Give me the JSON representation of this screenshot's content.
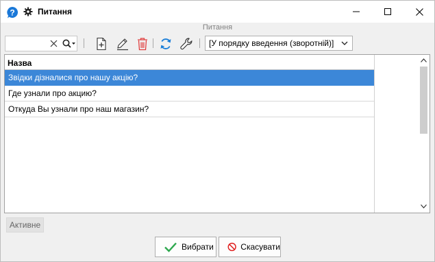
{
  "window": {
    "title": "Питання",
    "icons": {
      "help": "help-icon",
      "settings": "gear-icon"
    },
    "controls": [
      "minimize-icon",
      "maximize-icon",
      "close-icon"
    ]
  },
  "toolbar": {
    "caption": "Питання",
    "search": {
      "value": "",
      "placeholder": ""
    },
    "buttons": [
      "add-document-icon",
      "edit-pencil-icon",
      "delete-trash-icon",
      "refresh-icon",
      "settings-wrench-icon"
    ],
    "sort_selected": "[У порядку введення (зворотній)]"
  },
  "grid": {
    "column_header": "Назва",
    "rows": [
      "Звідки дізналися про нашу акцію?",
      "Где узнали про акцию?",
      "Откуда Вы узнали про наш магазин?"
    ],
    "selected_index": 0
  },
  "filter": {
    "active_label": "Активне"
  },
  "footer": {
    "select_label": "Вибрати",
    "cancel_label": "Скасувати"
  },
  "colors": {
    "selection": "#3c87d8",
    "help_blue": "#1a78d8",
    "delete_red": "#e03c3c",
    "refresh_blue": "#1a7ed8",
    "check_green": "#2fa84f",
    "cancel_red": "#e02020"
  }
}
